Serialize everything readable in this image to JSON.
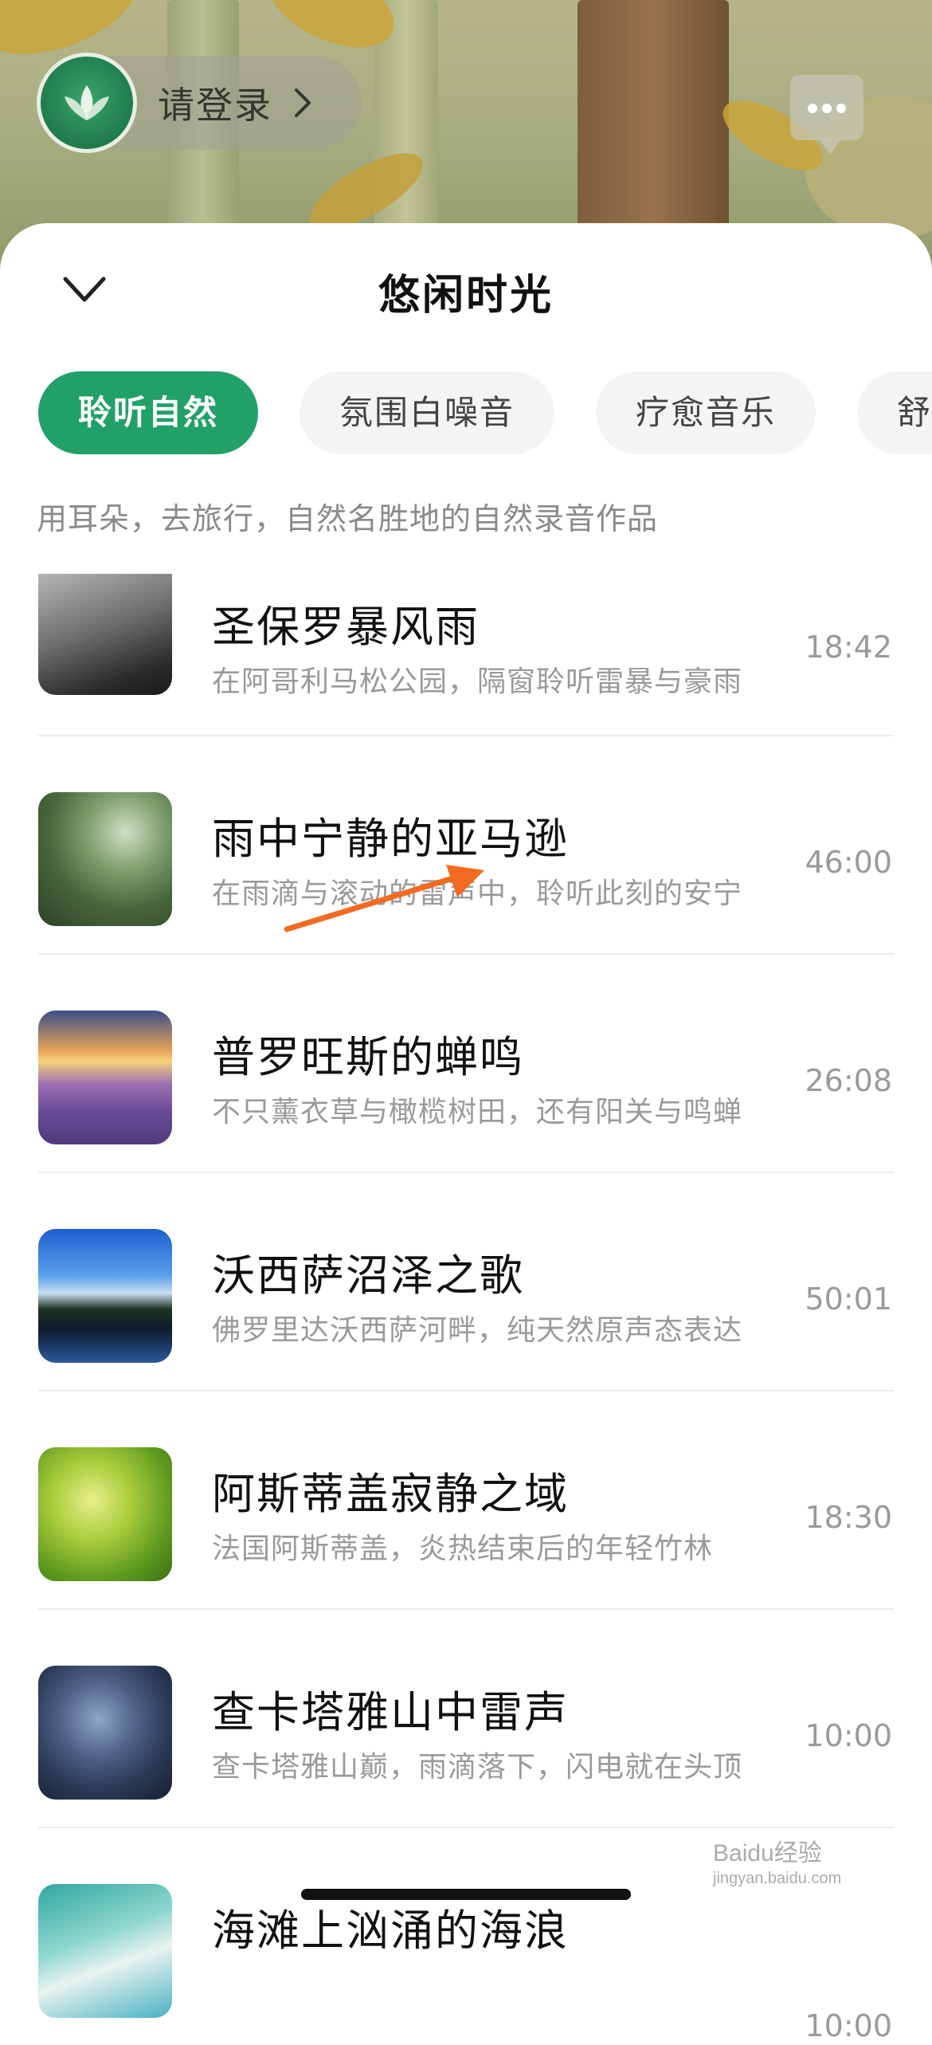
{
  "header": {
    "login_label": "请登录",
    "login_avatar_icon": "lotus-icon",
    "message_icon": "chat-bubble-icon"
  },
  "sheet": {
    "title": "悠闲时光",
    "collapse_icon": "chevron-down-icon",
    "tabs": [
      {
        "label": "聆听自然",
        "active": true
      },
      {
        "label": "氛围白噪音",
        "active": false
      },
      {
        "label": "疗愈音乐",
        "active": false
      },
      {
        "label": "舒缓",
        "active": false
      }
    ],
    "description": "用耳朵，去旅行，自然名胜地的自然录音作品",
    "items": [
      {
        "title": "圣保罗暴风雨",
        "subtitle": "在阿哥利马松公园，隔窗聆听雷暴与豪雨",
        "duration": "18:42",
        "thumb": "gray-rain-window"
      },
      {
        "title": "雨中宁静的亚马逊",
        "subtitle": "在雨滴与滚动的雷声中，聆听此刻的安宁",
        "duration": "46:00",
        "thumb": "green-rainforest"
      },
      {
        "title": "普罗旺斯的蝉鸣",
        "subtitle": "不只薰衣草与橄榄树田，还有阳关与鸣蝉",
        "duration": "26:08",
        "thumb": "lavender-field-sunset"
      },
      {
        "title": "沃西萨沼泽之歌",
        "subtitle": "佛罗里达沃西萨河畔，纯天然原声态表达",
        "duration": "50:01",
        "thumb": "blue-sky-river"
      },
      {
        "title": "阿斯蒂盖寂静之域",
        "subtitle": "法国阿斯蒂盖，炎热结束后的年轻竹林",
        "duration": "18:30",
        "thumb": "bamboo-leaves"
      },
      {
        "title": "查卡塔雅山中雷声",
        "subtitle": "查卡塔雅山巅，雨滴落下，闪电就在头顶",
        "duration": "10:00",
        "thumb": "lightning-storm"
      },
      {
        "title": "海滩上汹涌的海浪",
        "subtitle": "",
        "duration": "10:00",
        "thumb": "ocean-waves"
      }
    ]
  },
  "watermark": {
    "text": "Baidu经验",
    "url_text": "jingyan.baidu.com"
  },
  "colors": {
    "accent": "#22a069",
    "annotation_arrow": "#f36b21"
  }
}
